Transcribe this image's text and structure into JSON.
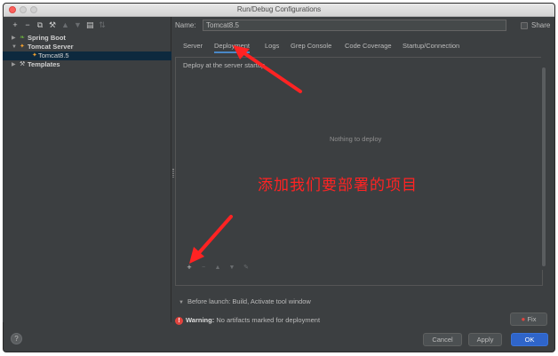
{
  "window": {
    "title": "Run/Debug Configurations"
  },
  "left_toolbar": {
    "icons": [
      "plus-icon",
      "minus-icon",
      "copy-icon",
      "wrench-icon",
      "move-up-icon",
      "move-down-icon",
      "folder-icon",
      "sort-icon"
    ]
  },
  "tree": {
    "items": [
      {
        "label": "Spring Boot",
        "expanded": false
      },
      {
        "label": "Tomcat Server",
        "expanded": true
      },
      {
        "label": "Tomcat8.5",
        "selected": true
      },
      {
        "label": "Templates",
        "expanded": false
      }
    ]
  },
  "form": {
    "name_label": "Name:",
    "name_value": "Tomcat8.5",
    "share_label": "Share",
    "share_checked": false
  },
  "tabs": [
    {
      "label": "Server"
    },
    {
      "label": "Deployment",
      "active": true
    },
    {
      "label": "Logs"
    },
    {
      "label": "Grep Console"
    },
    {
      "label": "Code Coverage"
    },
    {
      "label": "Startup/Connection"
    }
  ],
  "deployment": {
    "deploy_at_label": "Deploy at the server startup",
    "empty_text": "Nothing to deploy",
    "list_tools": [
      "add-icon",
      "remove-icon",
      "move-up-icon",
      "move-down-icon",
      "edit-icon"
    ]
  },
  "annotation": {
    "text": "添加我们要部署的项目",
    "color": "#ff2323"
  },
  "before_launch": {
    "label": "Before launch: Build, Activate tool window"
  },
  "warning": {
    "prefix": "Warning:",
    "message": "No artifacts marked for deployment",
    "fix_label": "Fix"
  },
  "buttons": {
    "help": "?",
    "cancel": "Cancel",
    "apply": "Apply",
    "ok": "OK"
  },
  "colors": {
    "background": "#3c3f41",
    "accent": "#2f65ca",
    "selection": "#0d293e",
    "warning": "#e0443e"
  }
}
